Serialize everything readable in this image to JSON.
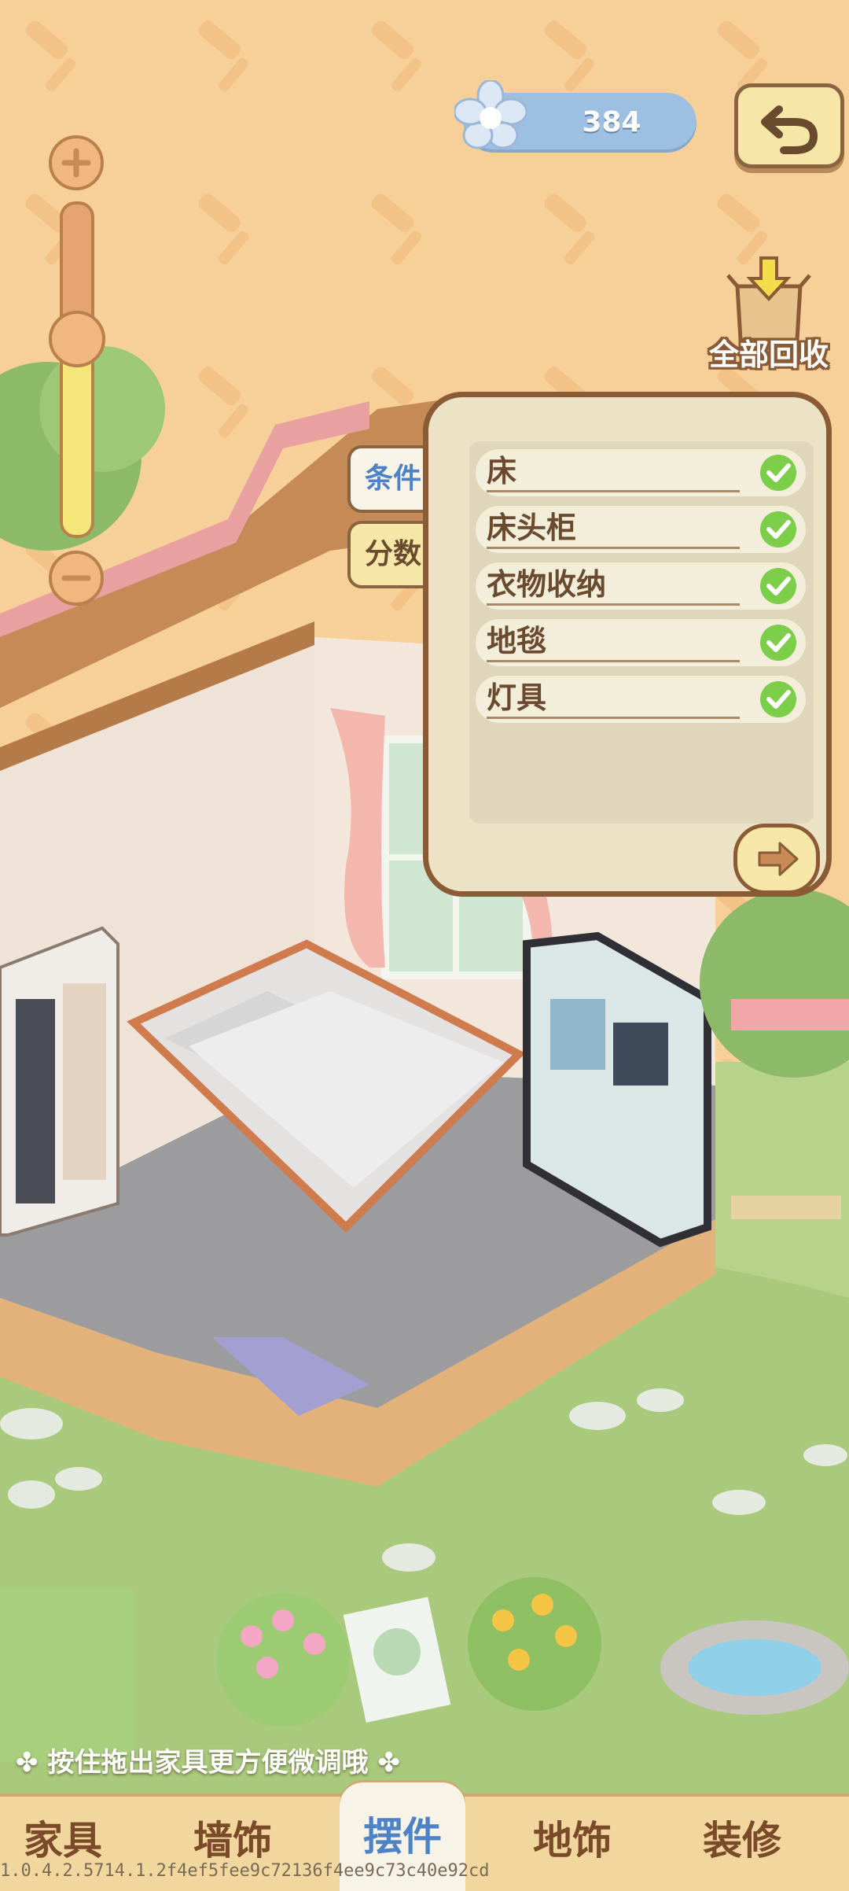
{
  "currency": {
    "amount": "384",
    "icon": "flower-icon"
  },
  "buttons": {
    "undo_icon": "undo-icon",
    "recycle_all": "全部回收"
  },
  "zoom": {
    "level": 0.6
  },
  "side_tabs": {
    "conditions": "条件",
    "score": "分数",
    "active": "条件"
  },
  "conditions": [
    {
      "label": "床",
      "done": true
    },
    {
      "label": "床头柜",
      "done": true
    },
    {
      "label": "衣物收纳",
      "done": true
    },
    {
      "label": "地毯",
      "done": true
    },
    {
      "label": "灯具",
      "done": true
    }
  ],
  "hint": "按住拖出家具更方便微调哦",
  "bottom_nav": {
    "tabs": [
      "家具",
      "墙饰",
      "摆件",
      "地饰",
      "装修"
    ],
    "active": "摆件"
  },
  "version": "1.0.4.2.5714.1.2f4ef5fee9c72136f4ee9c73c40e92cd",
  "colors": {
    "accent_blue": "#4d83c6",
    "check_green": "#7ccd4a",
    "frame_brown": "#8a5b35"
  }
}
